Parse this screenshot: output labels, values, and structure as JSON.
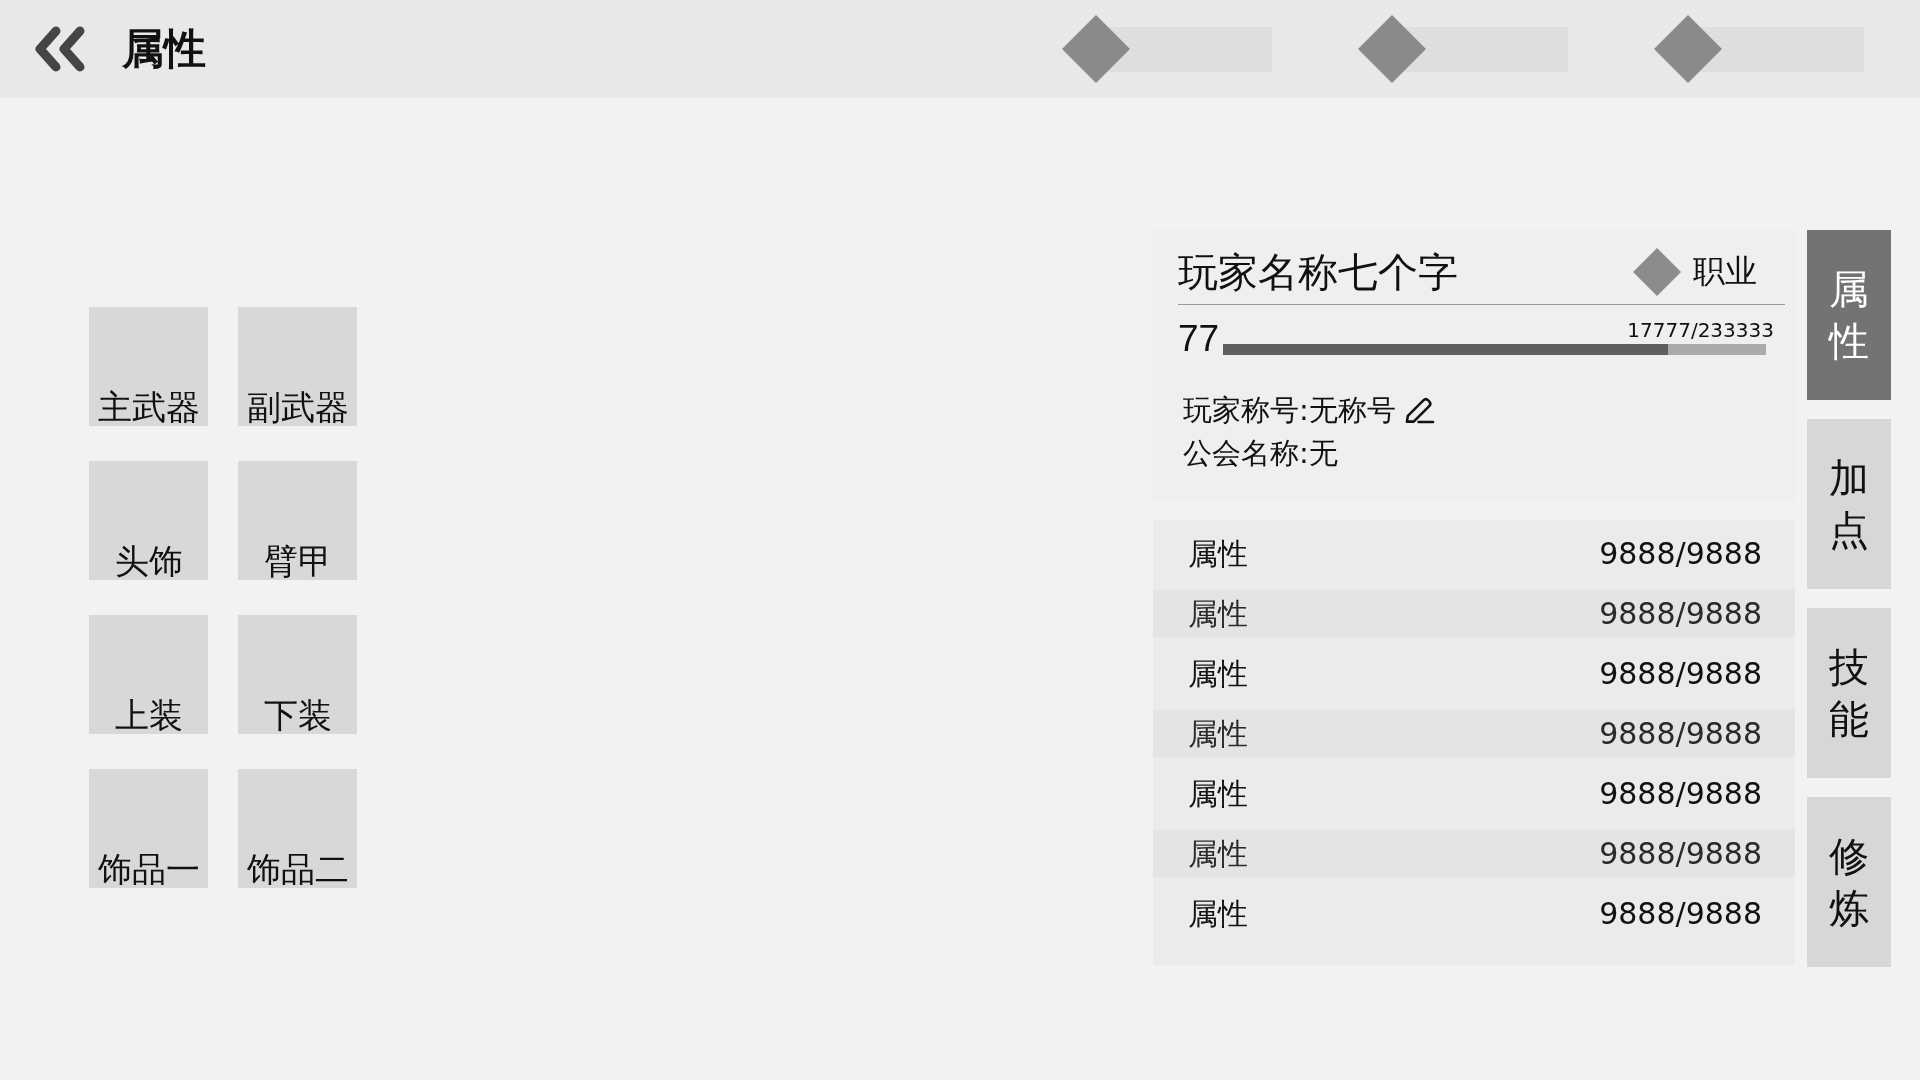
{
  "header": {
    "title": "属性"
  },
  "resource_slots": [
    {
      "kind": "currency"
    },
    {
      "kind": "currency"
    },
    {
      "kind": "currency"
    }
  ],
  "equipment_slots": [
    {
      "label": "主武器"
    },
    {
      "label": "副武器"
    },
    {
      "label": "头饰"
    },
    {
      "label": "臂甲"
    },
    {
      "label": "上装"
    },
    {
      "label": "下装"
    },
    {
      "label": "饰品一"
    },
    {
      "label": "饰品二"
    }
  ],
  "player": {
    "name": "玩家名称七个字",
    "class": "职业",
    "level_number": "77",
    "xp": {
      "reading": "17777/233333",
      "level": 0.82
    },
    "title_line": "玩家称号:无称号",
    "guild_line": "公会名称:无"
  },
  "attributes": [
    {
      "name": "属性",
      "value": "9888/9888"
    },
    {
      "name": "属性",
      "value": "9888/9888"
    },
    {
      "name": "属性",
      "value": "9888/9888"
    },
    {
      "name": "属性",
      "value": "9888/9888"
    },
    {
      "name": "属性",
      "value": "9888/9888"
    },
    {
      "name": "属性",
      "value": "9888/9888"
    },
    {
      "name": "属性",
      "value": "9888/9888"
    }
  ],
  "side_tabs": [
    {
      "label": "属性",
      "selected": true
    },
    {
      "label": "加点",
      "selected": false
    },
    {
      "label": "技能",
      "selected": false
    },
    {
      "label": "修炼",
      "selected": false
    }
  ]
}
